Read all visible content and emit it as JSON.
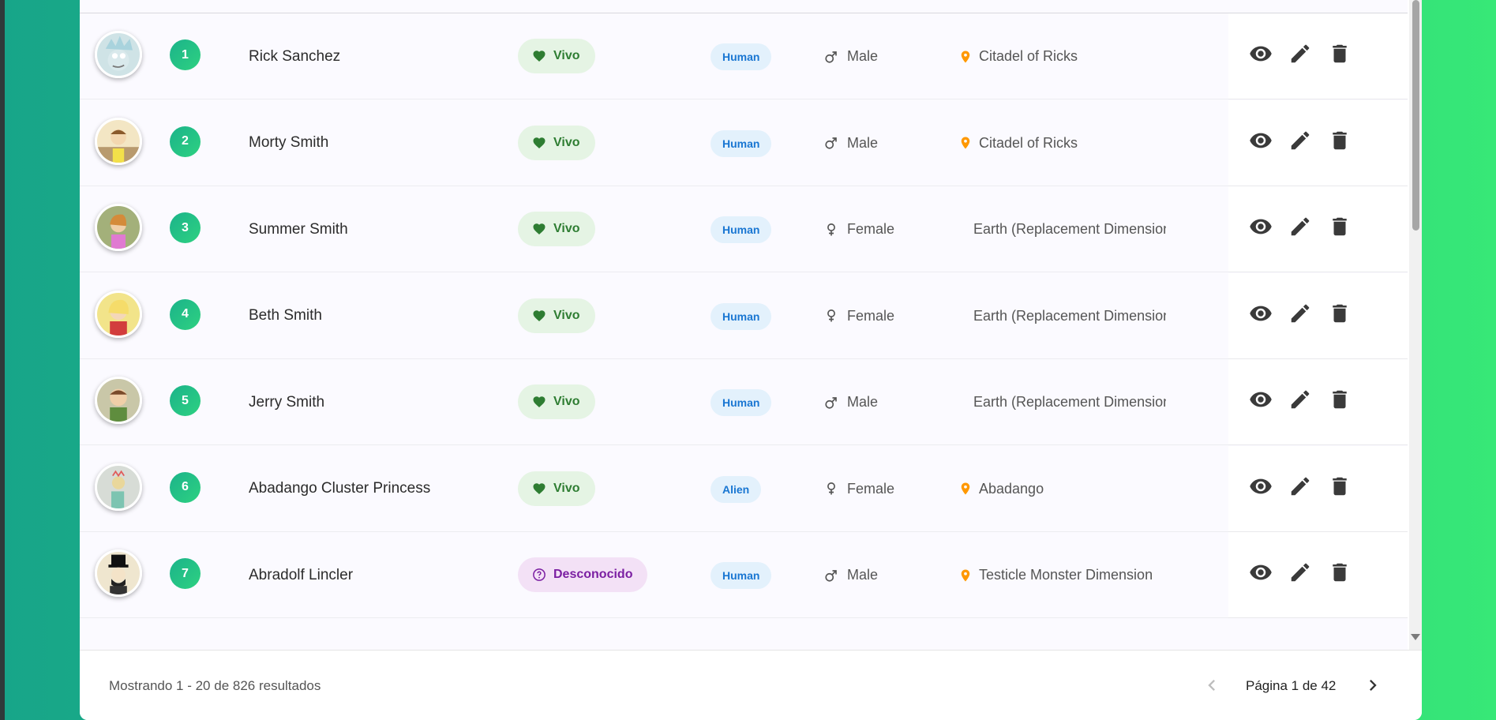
{
  "rows": [
    {
      "id": "1",
      "name": "Rick Sanchez",
      "status": "Vivo",
      "status_kind": "alive",
      "species": "Human",
      "gender": "Male",
      "location": "Citadel of Ricks",
      "show_pin": true,
      "avatar": "rick-avatar"
    },
    {
      "id": "2",
      "name": "Morty Smith",
      "status": "Vivo",
      "status_kind": "alive",
      "species": "Human",
      "gender": "Male",
      "location": "Citadel of Ricks",
      "show_pin": true,
      "avatar": "morty-avatar"
    },
    {
      "id": "3",
      "name": "Summer Smith",
      "status": "Vivo",
      "status_kind": "alive",
      "species": "Human",
      "gender": "Female",
      "location": "Earth (Replacement Dimension)",
      "show_pin": false,
      "avatar": "summer-avatar"
    },
    {
      "id": "4",
      "name": "Beth Smith",
      "status": "Vivo",
      "status_kind": "alive",
      "species": "Human",
      "gender": "Female",
      "location": "Earth (Replacement Dimension)",
      "show_pin": false,
      "avatar": "beth-avatar"
    },
    {
      "id": "5",
      "name": "Jerry Smith",
      "status": "Vivo",
      "status_kind": "alive",
      "species": "Human",
      "gender": "Male",
      "location": "Earth (Replacement Dimension)",
      "show_pin": false,
      "avatar": "jerry-avatar"
    },
    {
      "id": "6",
      "name": "Abadango Cluster Princess",
      "status": "Vivo",
      "status_kind": "alive",
      "species": "Alien",
      "gender": "Female",
      "location": "Abadango",
      "show_pin": true,
      "avatar": "princess-avatar"
    },
    {
      "id": "7",
      "name": "Abradolf Lincler",
      "status": "Desconocido",
      "status_kind": "unknown",
      "species": "Human",
      "gender": "Male",
      "location": "Testicle Monster Dimension",
      "show_pin": true,
      "avatar": "lincler-avatar"
    }
  ],
  "footer": {
    "results_text": "Mostrando 1 - 20 de 826 resultados",
    "page_text": "Página 1 de 42"
  },
  "colors": {
    "alive": "#2e7d32",
    "unknown": "#7b1fa2",
    "species": "#1976d2",
    "pin": "#ff9800",
    "id_badge": "#1bb38a"
  },
  "icons": {
    "view": "eye-icon",
    "edit": "pencil-icon",
    "delete": "trash-icon",
    "alive": "heart-icon",
    "unknown": "help-circle-icon",
    "male": "male-icon",
    "female": "female-icon",
    "location": "pin-icon",
    "prev": "chevron-left-icon",
    "next": "chevron-right-icon"
  }
}
